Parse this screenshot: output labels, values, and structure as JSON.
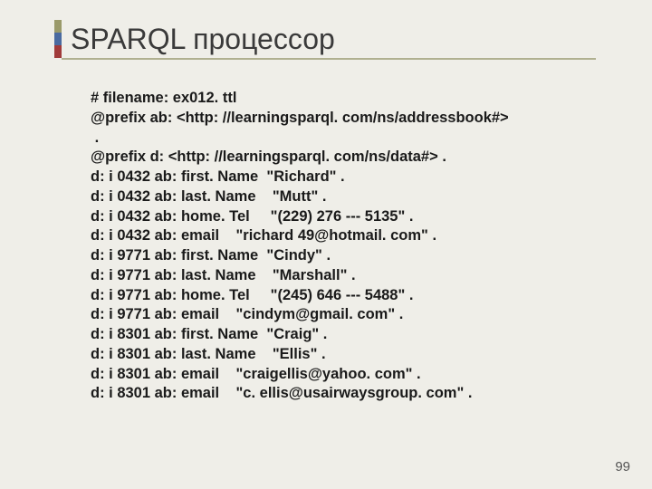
{
  "title": "SPARQL процессор",
  "code_lines": [
    "# filename: ex012. ttl",
    "@prefix ab: <http: //learningsparql. com/ns/addressbook#>",
    " .",
    "@prefix d: <http: //learningsparql. com/ns/data#> .",
    "d: i 0432 ab: first. Name  \"Richard\" .",
    "d: i 0432 ab: last. Name    \"Mutt\" .",
    "d: i 0432 ab: home. Tel     \"(229) 276 --- 5135\" .",
    "d: i 0432 ab: email    \"richard 49@hotmail. com\" .",
    "d: i 9771 ab: first. Name  \"Cindy\" .",
    "d: i 9771 ab: last. Name    \"Marshall\" .",
    "d: i 9771 ab: home. Tel     \"(245) 646 --- 5488\" .",
    "d: i 9771 ab: email    \"cindym@gmail. com\" .",
    "d: i 8301 ab: first. Name  \"Craig\" .",
    "d: i 8301 ab: last. Name    \"Ellis\" .",
    "d: i 8301 ab: email    \"craigellis@yahoo. com\" .",
    "d: i 8301 ab: email    \"c. ellis@usairwaysgroup. com\" ."
  ],
  "page_number": "99"
}
